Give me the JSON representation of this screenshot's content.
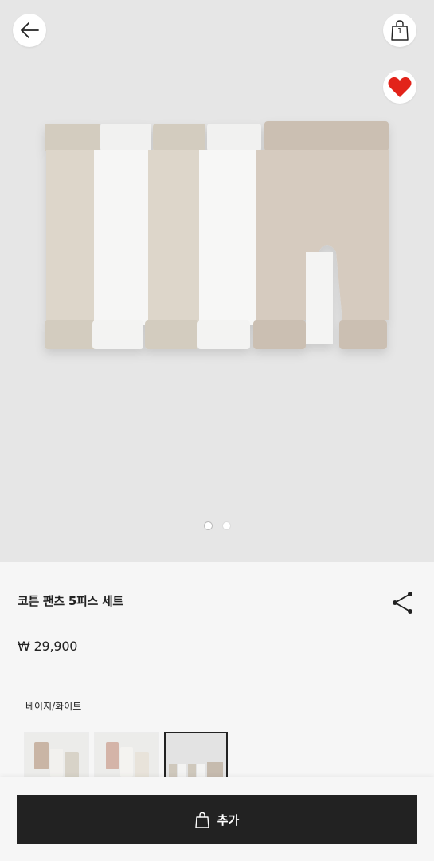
{
  "header": {
    "back_icon": "arrow-left-icon",
    "bag_icon": "shopping-bag-icon",
    "bag_count": "1",
    "favorite_icon": "heart-filled-icon",
    "favorite_color": "#e2231a"
  },
  "carousel": {
    "image": "product-photo",
    "total_images": 2,
    "active_index": 0
  },
  "product": {
    "title": "코튼 팬츠 5피스 세트",
    "price": "₩ 29,900",
    "color_name": "베이지/화이트",
    "share_icon": "share-icon"
  },
  "swatches": [
    {
      "name": "beige-pink-white",
      "selected": false
    },
    {
      "name": "pink-white",
      "selected": false
    },
    {
      "name": "beige-white",
      "selected": true
    }
  ],
  "cta": {
    "label": "추가",
    "icon": "shopping-bag-icon"
  }
}
